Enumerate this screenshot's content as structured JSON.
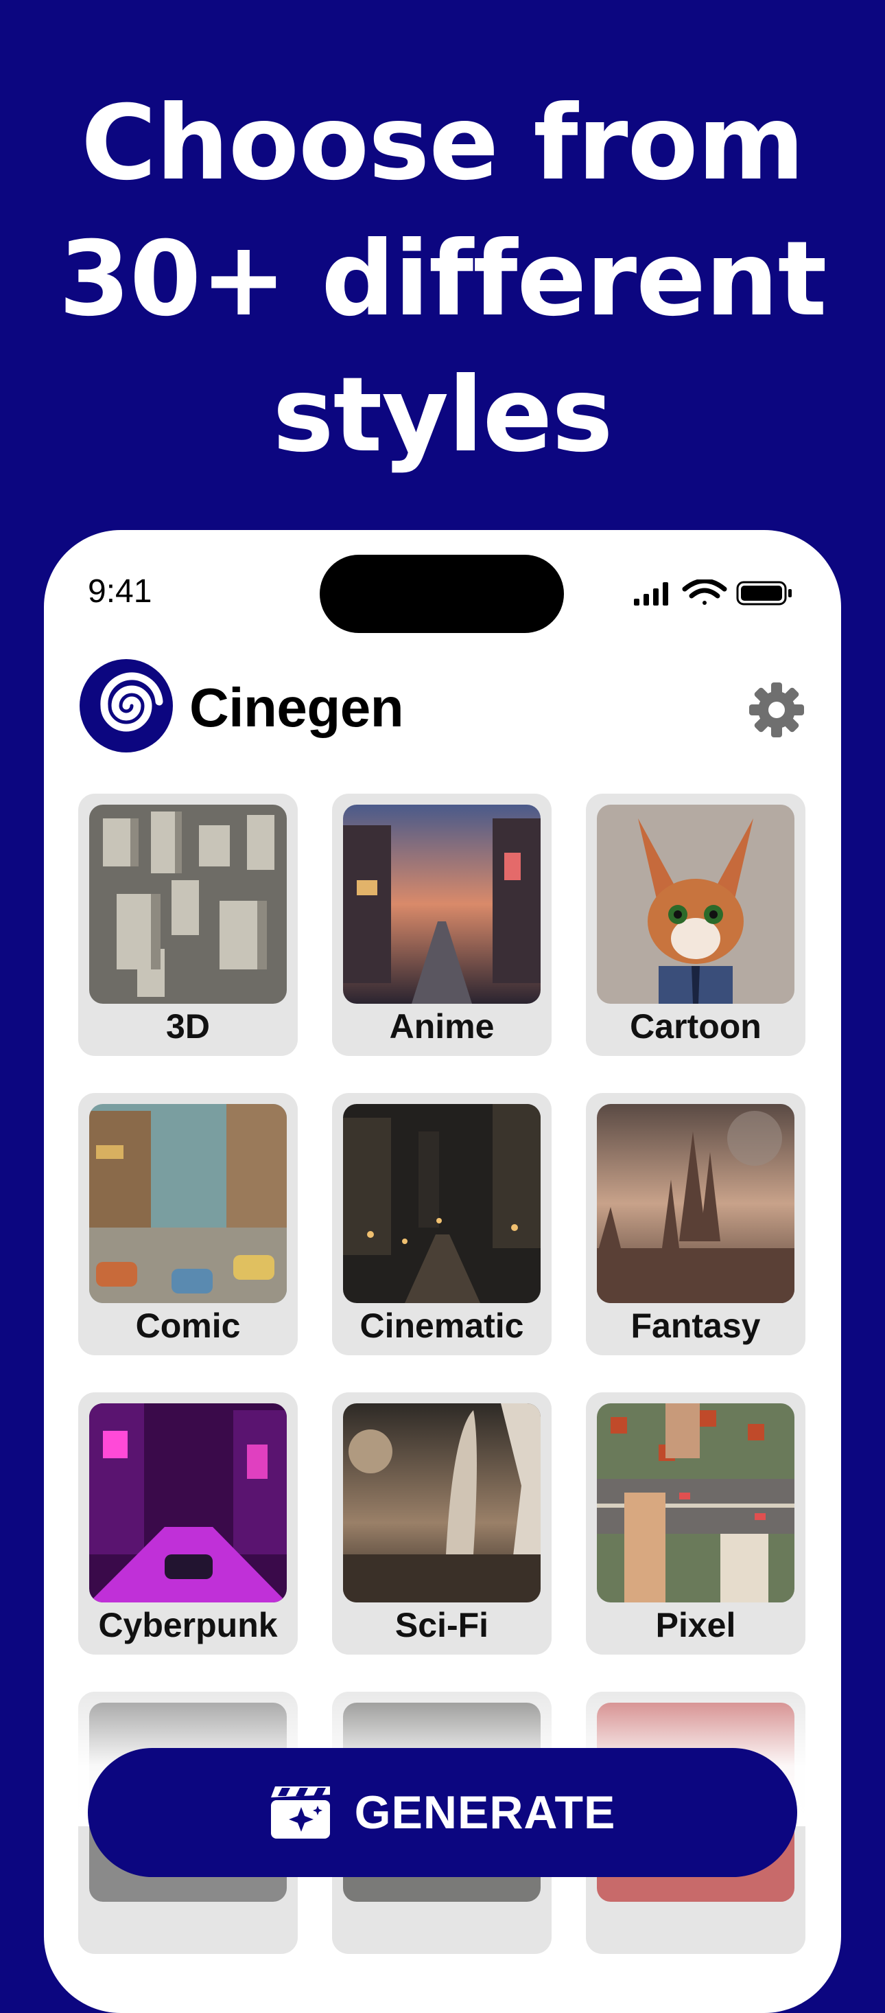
{
  "headline": {
    "line1": "Choose from",
    "line2": "30+ different",
    "line3": "styles"
  },
  "status_bar": {
    "time": "9:41"
  },
  "app": {
    "name": "Cinegen"
  },
  "styles": [
    {
      "label": "3D"
    },
    {
      "label": "Anime"
    },
    {
      "label": "Cartoon"
    },
    {
      "label": "Comic"
    },
    {
      "label": "Cinematic"
    },
    {
      "label": "Fantasy"
    },
    {
      "label": "Cyberpunk"
    },
    {
      "label": "Sci-Fi"
    },
    {
      "label": "Pixel"
    }
  ],
  "generate_button": {
    "label": "GENERATE"
  },
  "colors": {
    "brand": "#0c0680",
    "card": "#e5e5e5",
    "gear": "#6f6f6f"
  }
}
